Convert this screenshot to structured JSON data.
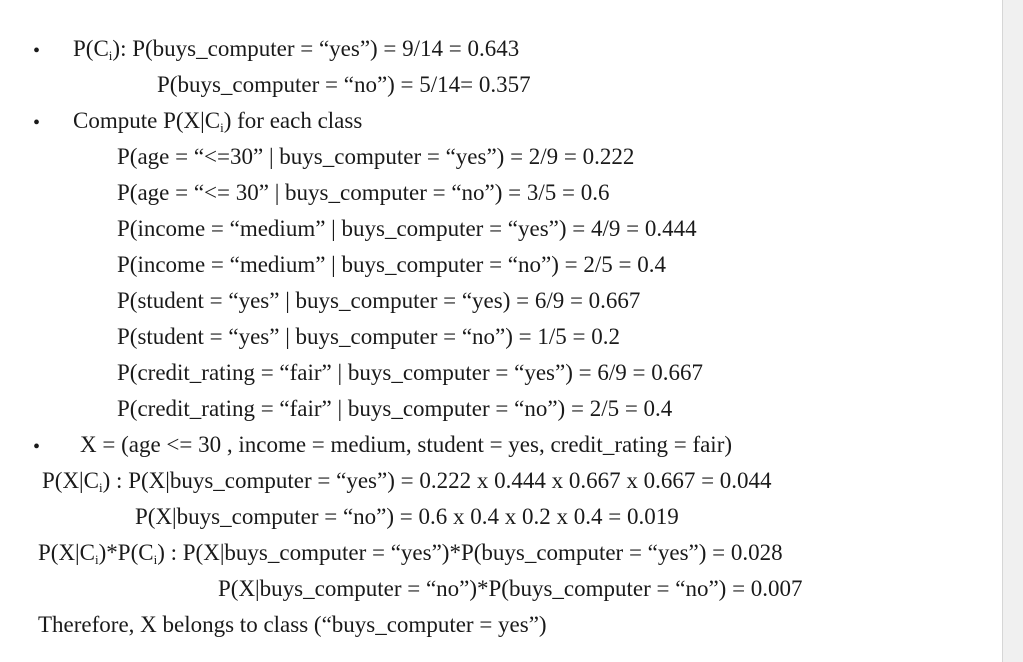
{
  "lines": {
    "l1": [
      "P(C",
      "i",
      "):   P(buys_computer = “yes”)  = 9/14 = 0.643"
    ],
    "l2": "P(buys_computer = “no”) = 5/14= 0.357",
    "l3": [
      "Compute P(X|C",
      "i",
      ") for each class"
    ],
    "l4": "P(age = “<=30” | buys_computer = “yes”)  = 2/9 = 0.222",
    "l5": "P(age = “<= 30” | buys_computer = “no”) = 3/5 = 0.6",
    "l6": "P(income = “medium” | buys_computer = “yes”) = 4/9 = 0.444",
    "l7": "P(income = “medium” | buys_computer = “no”) = 2/5 = 0.4",
    "l8": "P(student = “yes” | buys_computer = “yes) = 6/9 = 0.667",
    "l9": "P(student = “yes” | buys_computer = “no”) = 1/5 = 0.2",
    "l10": "P(credit_rating = “fair” | buys_computer = “yes”) = 6/9 = 0.667",
    "l11": "P(credit_rating = “fair” | buys_computer = “no”) = 2/5 = 0.4",
    "l12": "X = (age <= 30 , income = medium, student = yes, credit_rating = fair)",
    "l13": [
      "P(X|C",
      "i",
      ") : P(X|buys_computer = “yes”) = 0.222 x 0.444 x 0.667 x 0.667 = 0.044"
    ],
    "l14": "P(X|buys_computer = “no”) = 0.6 x 0.4 x 0.2 x 0.4 = 0.019",
    "l15": [
      "P(X|C",
      "i",
      ")*P(C",
      "i",
      ") : P(X|buys_computer = “yes”)*P(buys_computer = “yes”) = 0.028"
    ],
    "l16": "P(X|buys_computer = “no”)*P(buys_computer = “no”) = 0.007",
    "l17": "Therefore,  X belongs to class (“buys_computer = yes”)"
  },
  "bullet_glyph": "•"
}
